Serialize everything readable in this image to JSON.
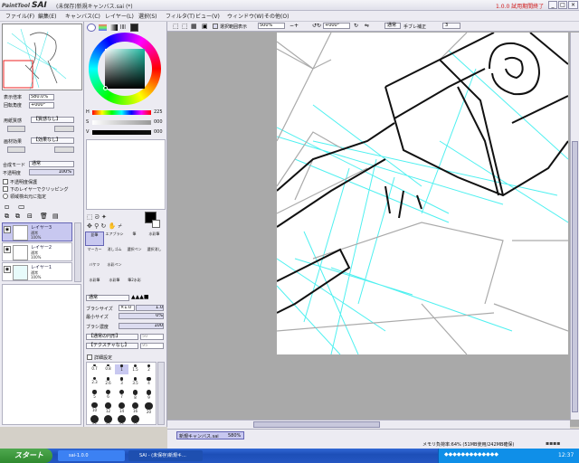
{
  "titlebar": {
    "logo_small": "PaintTool",
    "logo_big": "SAI",
    "doc": "(未保存)新規キャンバス.sai (*)",
    "trial": "1.0.0 試用期間終了",
    "min": "_",
    "max": "□",
    "close": "×"
  },
  "menu": {
    "file": "ファイル(F)",
    "edit": "編集(E)",
    "canvas": "キャンバス(C)",
    "layer": "レイヤー(L)",
    "select": "選択(S)",
    "filter": "フィルタ(T)",
    "view": "ビュー(V)",
    "window": "ウィンドウ(W)",
    "others": "その他(O)"
  },
  "left": {
    "zoom_label": "表示倍率",
    "zoom_value": "580.0%",
    "angle_label": "回転角度",
    "angle_value": "+000°",
    "paper_label": "用紙質感",
    "paper_value": "【質感なし】",
    "effect_label": "画材効果",
    "effect_value": "【効果なし】",
    "blend_label": "合成モード",
    "blend_value": "通常",
    "opacity_label": "不透明度",
    "opacity_value": "100%",
    "chk1": "不透明度保護",
    "chk2": "下のレイヤーでクリッピング",
    "chk3": "領域検出元に指定",
    "layers": [
      {
        "name": "レイヤー3",
        "mode": "通常",
        "opacity": "100%"
      },
      {
        "name": "レイヤー2",
        "mode": "通常",
        "opacity": "100%"
      },
      {
        "name": "レイヤー1",
        "mode": "通常",
        "opacity": "100%"
      }
    ]
  },
  "color": {
    "h_label": "H",
    "h_value": "225",
    "s_label": "S",
    "s_value": "000",
    "v_label": "V",
    "v_value": "000"
  },
  "tools": {
    "row1": [
      "鉛筆",
      "エアブラシ",
      "筆",
      "水彩筆"
    ],
    "row2": [
      "マーカー",
      "消しゴム",
      "選択ペン",
      "選択消し"
    ],
    "row3": [
      "バケツ",
      "水彩ペン"
    ],
    "row4": [
      "水彩筆",
      "水彩筆",
      "筆2水彩"
    ],
    "mode_value": "通常",
    "brush_size_label": "ブラシサイズ",
    "brush_size_mult": "×1.0",
    "brush_size_value": "1.0",
    "min_size_label": "最小サイズ",
    "min_size_value": "0%",
    "density_label": "ブラシ濃度",
    "density_value": "100",
    "shape_value": "【通常の円形】",
    "shape_num": "50",
    "texture_value": "【テクスチャなし】",
    "texture_num": "95",
    "detail_label": "詳細設定",
    "sizes": [
      "0.7",
      "0.8",
      "1",
      "1.5",
      "2",
      "2.3",
      "2.6",
      "3",
      "3.5",
      "4",
      "5",
      "6",
      "7",
      "8",
      "9",
      "10",
      "12",
      "14",
      "16",
      "20",
      "25",
      "30",
      "35",
      "40"
    ]
  },
  "canvas_bar": {
    "stabilizer_label": "選択範囲表示",
    "zoom": "500%",
    "angle": "+000°",
    "mode": "通常",
    "hand_label": "手ブレ補正",
    "hand_value": "3"
  },
  "status": {
    "tab": "新規キャンバス.sai",
    "tab_zoom": "580%",
    "memory": "メモリ負荷率:64% (51MB使用/242MB確保)"
  },
  "taskbar": {
    "start": "スタート",
    "task1": "sai-1.0.0",
    "task2": "SAI - (未保存)新規キ...",
    "clock": "12:37"
  },
  "colors": {
    "accent": "#c8c8f0",
    "panel": "#ecebf2",
    "canvas_bg": "#a9a9a9",
    "cyan_line": "#4ff0f0"
  }
}
